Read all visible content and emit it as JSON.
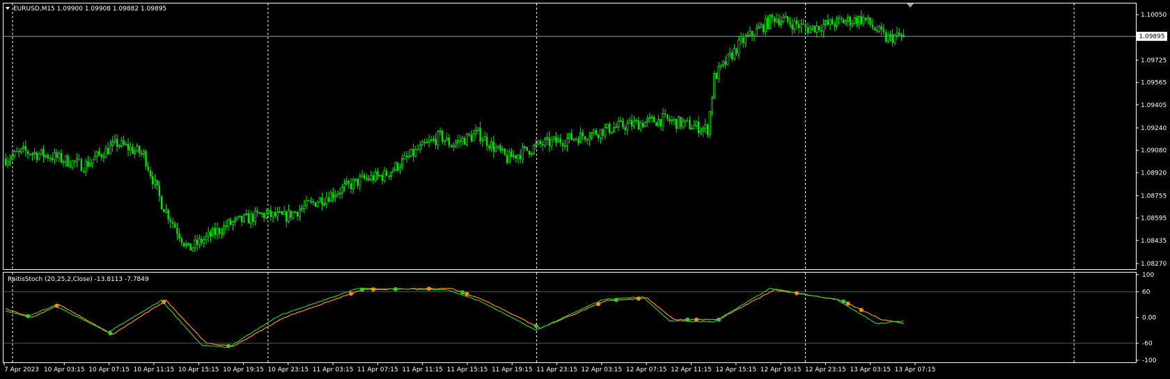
{
  "main_pane": {
    "symbol_info": "EURUSD,M15  1.09900 1.09908 1.09882 1.09895",
    "current_price": "1.09895"
  },
  "indicator_pane": {
    "info": "RaitisStoch (20,25,2,Close) -13.8113 -7.7849"
  },
  "colors": {
    "background": "#000000",
    "candle": "#00e600",
    "grid": "#ffffff",
    "price_line": "#8aa2b8",
    "stoch_main": "#ff8c1a",
    "stoch_signal": "#22cc22",
    "level_line": "#1f6e52",
    "dot_orange": "#ff8c1a",
    "dot_green": "#33cc33"
  },
  "chart_data": [
    {
      "type": "candlestick",
      "title": "EURUSD,M15",
      "y_ticks": [
        "1.10050",
        "1.09725",
        "1.09565",
        "1.09405",
        "1.09240",
        "1.09080",
        "1.08920",
        "1.08755",
        "1.08595",
        "1.08435",
        "1.08270"
      ],
      "ylim": [
        1.0823,
        1.1013
      ],
      "x_ticks": [
        "7 Apr 2023",
        "10 Apr 03:15",
        "10 Apr 07:15",
        "10 Apr 11:15",
        "10 Apr 15:15",
        "10 Apr 19:15",
        "10 Apr 23:15",
        "11 Apr 03:15",
        "11 Apr 07:15",
        "11 Apr 11:15",
        "11 Apr 15:15",
        "11 Apr 19:15",
        "11 Apr 23:15",
        "12 Apr 03:15",
        "12 Apr 07:15",
        "12 Apr 11:15",
        "12 Apr 15:15",
        "12 Apr 19:15",
        "12 Apr 23:15",
        "13 Apr 03:15",
        "13 Apr 07:15"
      ],
      "close_anchors": [
        [
          0,
          1.0902
        ],
        [
          8,
          1.0907
        ],
        [
          20,
          1.0904
        ],
        [
          35,
          1.0897
        ],
        [
          50,
          1.0913
        ],
        [
          62,
          1.0905
        ],
        [
          70,
          1.087
        ],
        [
          82,
          1.0837
        ],
        [
          100,
          1.0855
        ],
        [
          115,
          1.0862
        ],
        [
          125,
          1.086
        ],
        [
          140,
          1.0872
        ],
        [
          160,
          1.0887
        ],
        [
          170,
          1.089
        ],
        [
          185,
          1.0908
        ],
        [
          195,
          1.0918
        ],
        [
          200,
          1.0912
        ],
        [
          212,
          1.092
        ],
        [
          225,
          1.0902
        ],
        [
          240,
          1.0912
        ],
        [
          258,
          1.0918
        ],
        [
          275,
          1.0925
        ],
        [
          295,
          1.093
        ],
        [
          315,
          1.0923
        ],
        [
          318,
          1.096
        ],
        [
          330,
          1.0985
        ],
        [
          345,
          1.1003
        ],
        [
          360,
          1.0995
        ],
        [
          375,
          1.1
        ],
        [
          385,
          1.1002
        ],
        [
          395,
          1.0988
        ],
        [
          403,
          1.099
        ]
      ],
      "last_close": 1.09895,
      "bar_count": 404
    },
    {
      "type": "line",
      "title": "RaitisStoch (20,25,2,Close)",
      "y_ticks": [
        "100",
        "60",
        "0.00",
        "-60",
        "-100"
      ],
      "ylim": [
        -100,
        100
      ],
      "levels": [
        60,
        -60
      ],
      "series": [
        {
          "name": "",
          "color_key": "stoch_main",
          "anchors": [
            [
              0,
              20
            ],
            [
              12,
              0
            ],
            [
              24,
              30
            ],
            [
              48,
              -40
            ],
            [
              72,
              40
            ],
            [
              90,
              -60
            ],
            [
              102,
              -68
            ],
            [
              125,
              0
            ],
            [
              160,
              65
            ],
            [
              200,
              68
            ],
            [
              215,
              40
            ],
            [
              240,
              -25
            ],
            [
              270,
              40
            ],
            [
              288,
              45
            ],
            [
              300,
              -5
            ],
            [
              320,
              -5
            ],
            [
              345,
              65
            ],
            [
              375,
              40
            ],
            [
              393,
              -5
            ],
            [
              403,
              -13.8
            ]
          ]
        },
        {
          "name": "",
          "color_key": "stoch_signal",
          "anchors": [
            [
              0,
              15
            ],
            [
              10,
              2
            ],
            [
              22,
              28
            ],
            [
              46,
              -35
            ],
            [
              70,
              40
            ],
            [
              88,
              -65
            ],
            [
              100,
              -70
            ],
            [
              123,
              5
            ],
            [
              158,
              68
            ],
            [
              198,
              65
            ],
            [
              213,
              38
            ],
            [
              238,
              -30
            ],
            [
              268,
              42
            ],
            [
              286,
              48
            ],
            [
              298,
              -8
            ],
            [
              318,
              -10
            ],
            [
              343,
              68
            ],
            [
              373,
              42
            ],
            [
              391,
              -15
            ],
            [
              403,
              -7.8
            ]
          ]
        }
      ],
      "dots": [
        {
          "x": 10,
          "color": "green"
        },
        {
          "x": 23,
          "color": "orange"
        },
        {
          "x": 47,
          "color": "green"
        },
        {
          "x": 71,
          "color": "orange"
        },
        {
          "x": 100,
          "color": "green"
        },
        {
          "x": 155,
          "color": "orange"
        },
        {
          "x": 160,
          "color": "green"
        },
        {
          "x": 165,
          "color": "orange"
        },
        {
          "x": 175,
          "color": "green"
        },
        {
          "x": 190,
          "color": "orange"
        },
        {
          "x": 205,
          "color": "green"
        },
        {
          "x": 207,
          "color": "orange"
        },
        {
          "x": 238,
          "color": "green"
        },
        {
          "x": 266,
          "color": "orange"
        },
        {
          "x": 274,
          "color": "green"
        },
        {
          "x": 284,
          "color": "orange"
        },
        {
          "x": 306,
          "color": "green"
        },
        {
          "x": 310,
          "color": "orange"
        },
        {
          "x": 320,
          "color": "green"
        },
        {
          "x": 355,
          "color": "orange"
        },
        {
          "x": 376,
          "color": "green"
        },
        {
          "x": 378,
          "color": "orange"
        },
        {
          "x": 384,
          "color": "orange"
        }
      ]
    }
  ]
}
